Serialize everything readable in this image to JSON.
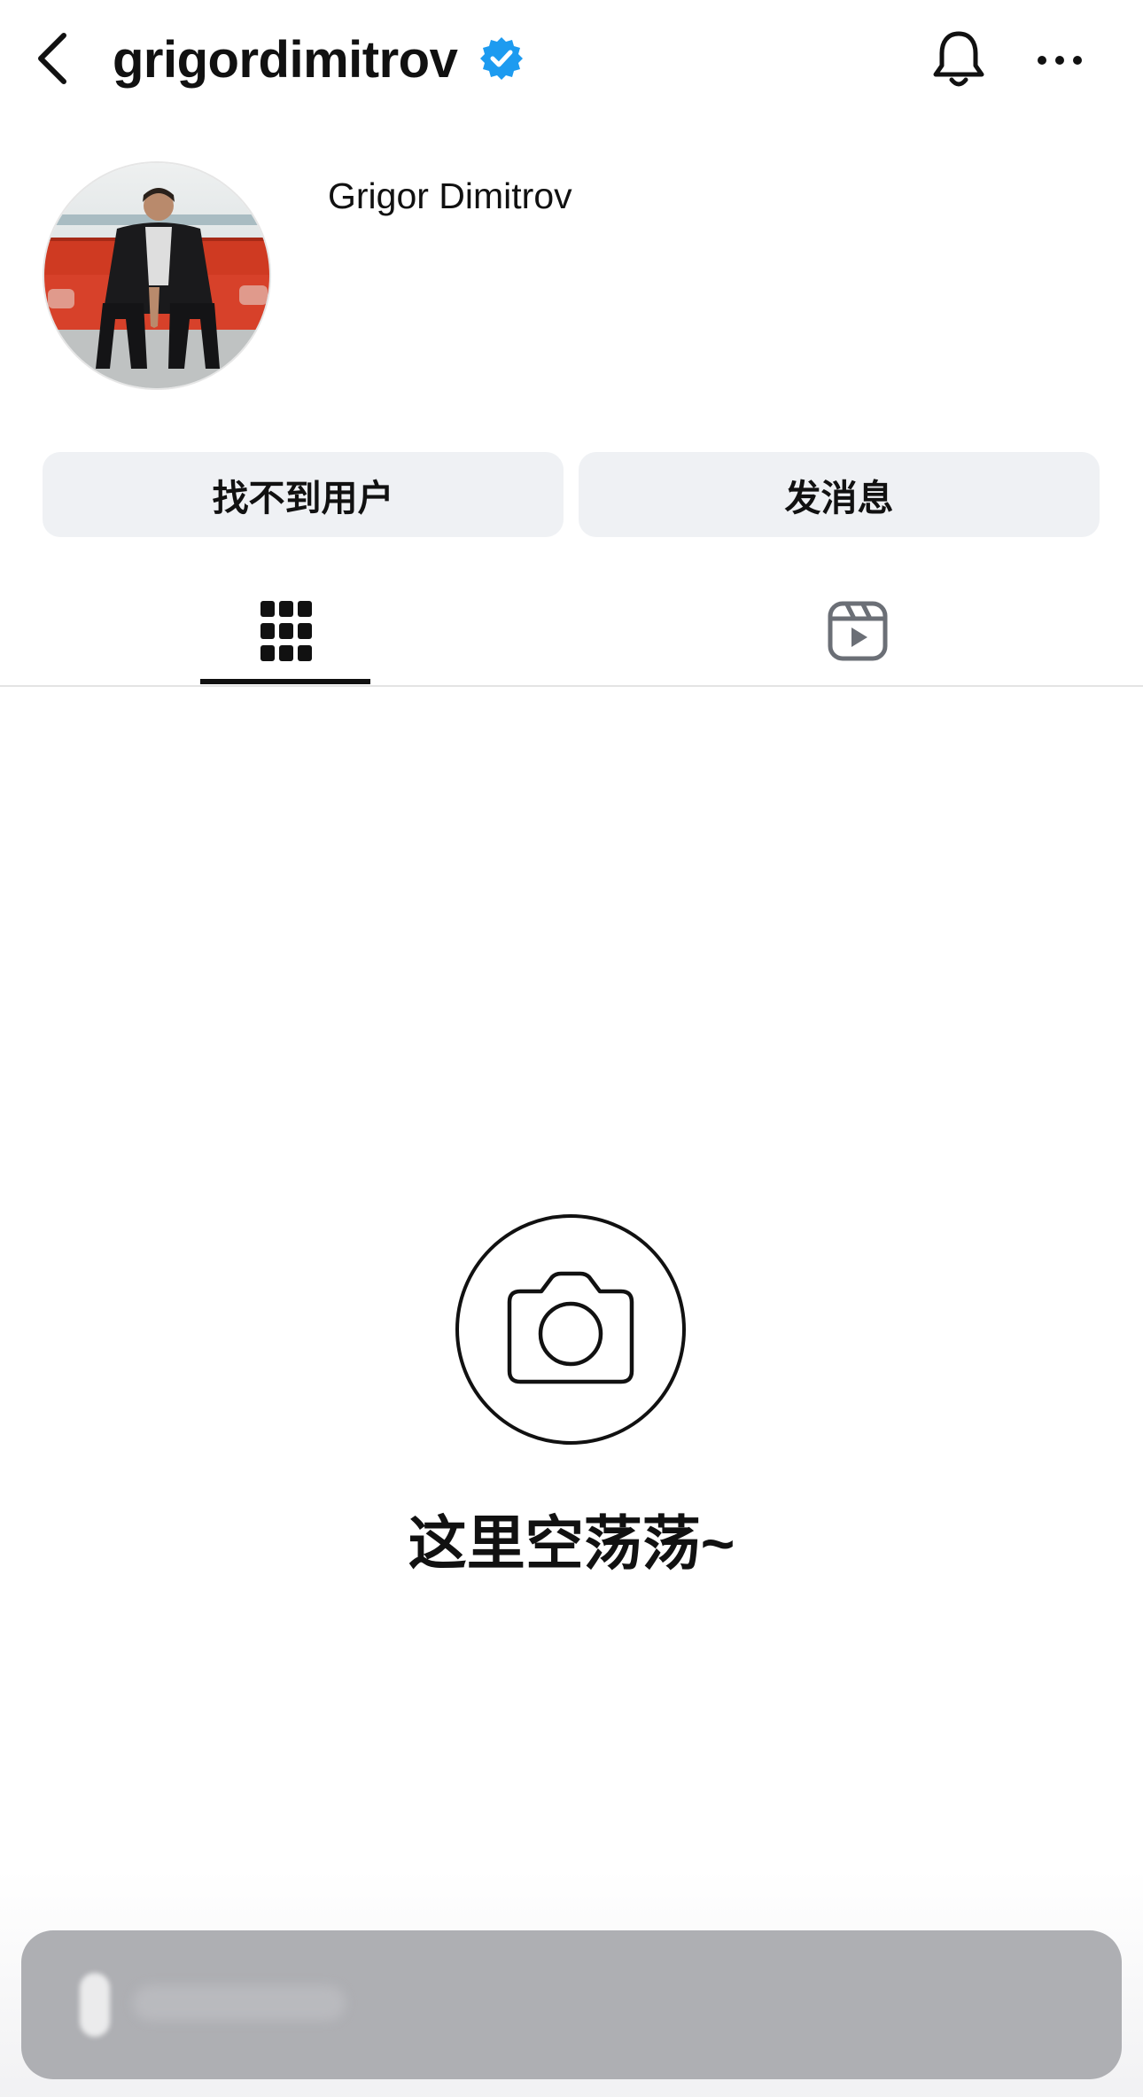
{
  "header": {
    "username": "grigordimitrov",
    "verified": true,
    "icons": {
      "back": "chevron-left-icon",
      "verified": "verified-badge-icon",
      "notifications": "bell-icon",
      "more": "more-horizontal-icon"
    }
  },
  "profile": {
    "display_name": "Grigor Dimitrov",
    "avatar": "profile-photo"
  },
  "actions": {
    "left_label": "找不到用户",
    "right_label": "发消息"
  },
  "tabs": [
    {
      "name": "grid",
      "icon": "grid-icon",
      "active": true
    },
    {
      "name": "reels",
      "icon": "reels-icon",
      "active": false
    }
  ],
  "empty_state": {
    "icon": "camera-icon",
    "message": "这里空荡荡~"
  },
  "colors": {
    "verified_blue": "#1d9bf0",
    "button_bg": "#eff1f4",
    "bottom_bar": "#aeafb3",
    "text": "#111111"
  }
}
